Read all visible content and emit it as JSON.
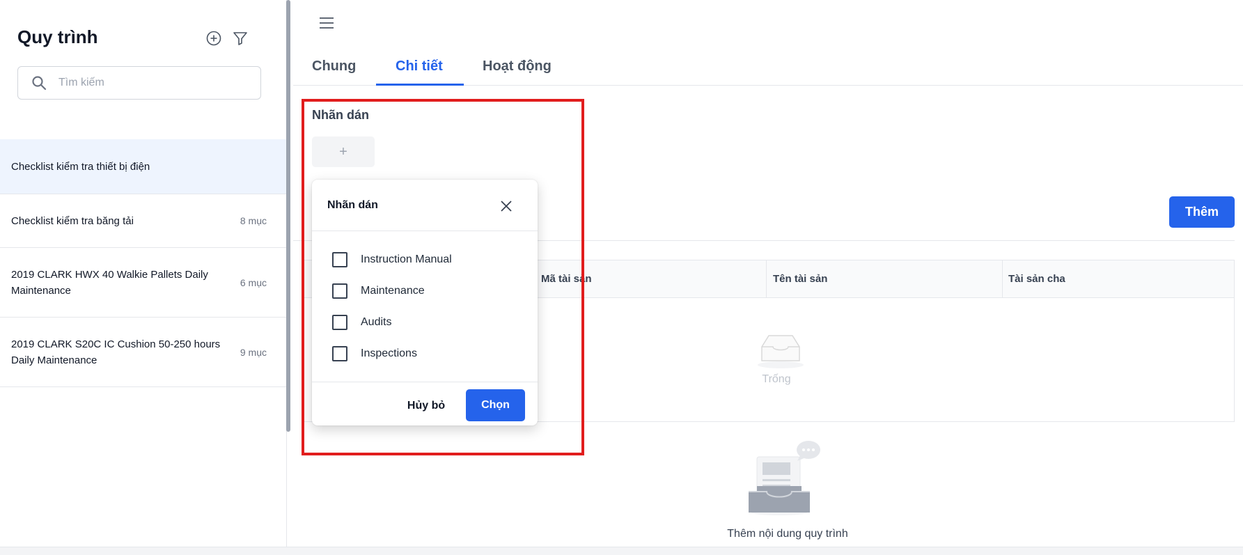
{
  "sidebar": {
    "title": "Quy trình",
    "search_placeholder": "Tìm kiếm",
    "items": [
      {
        "name": "Checklist kiểm tra thiết bị điện",
        "count": ""
      },
      {
        "name": "Checklist kiểm tra băng tải",
        "count": "8 mục"
      },
      {
        "name": "2019 CLARK HWX 40 Walkie Pallets Daily Maintenance",
        "count": "6 mục"
      },
      {
        "name": "2019 CLARK S20C IC Cushion 50-250 hours Daily Maintenance",
        "count": "9 mục"
      }
    ]
  },
  "main": {
    "tabs": [
      {
        "label": "Chung"
      },
      {
        "label": "Chi tiết"
      },
      {
        "label": "Hoạt động"
      }
    ],
    "active_tab": "Chi tiết",
    "labels_title": "Nhãn dán",
    "add_tag_symbol": "+",
    "add_button": "Thêm",
    "table": {
      "columns": [
        "Mã tài sản",
        "Tên tài sản",
        "Tài sản cha"
      ],
      "empty_text": "Trống"
    },
    "content_hint": "Thêm nội dung quy trình"
  },
  "popup": {
    "title": "Nhãn dán",
    "options": [
      {
        "label": "Instruction Manual",
        "checked": false
      },
      {
        "label": "Maintenance",
        "checked": false
      },
      {
        "label": "Audits",
        "checked": false
      },
      {
        "label": "Inspections",
        "checked": false
      }
    ],
    "cancel_label": "Hủy bỏ",
    "choose_label": "Chọn"
  },
  "colors": {
    "primary": "#2563eb",
    "highlight": "#e11d1d",
    "active_item_bg": "#eef4fe"
  },
  "icons": {
    "add": "plus-circle-icon",
    "filter": "filter-icon",
    "search": "search-icon",
    "menu": "hamburger-menu-icon",
    "close": "close-icon",
    "empty": "empty-inbox-icon",
    "content": "inbox-chat-illustration"
  }
}
